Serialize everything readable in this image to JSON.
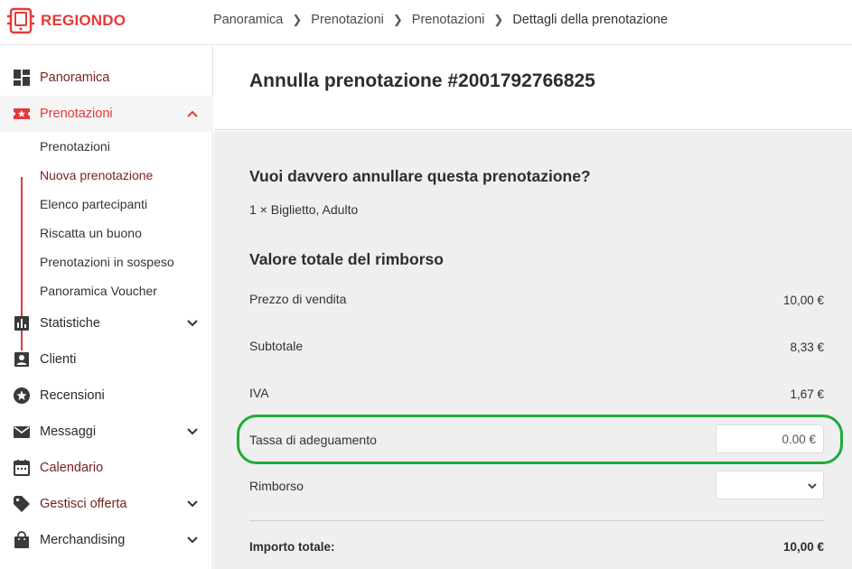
{
  "brand": {
    "name": "REGIONDO",
    "accent": "#e43a3a",
    "highlight": "#1dab3b"
  },
  "breadcrumb": [
    "Panoramica",
    "Prenotazioni",
    "Prenotazioni",
    "Dettagli della prenotazione"
  ],
  "sidebar": {
    "items": [
      {
        "label": "Panoramica",
        "icon": "dashboard-icon"
      },
      {
        "label": "Prenotazioni",
        "icon": "ticket-star-icon",
        "expanded": true
      },
      {
        "label": "Statistiche",
        "icon": "bar-chart-icon"
      },
      {
        "label": "Clienti",
        "icon": "contact-icon"
      },
      {
        "label": "Recensioni",
        "icon": "star-badge-icon"
      },
      {
        "label": "Messaggi",
        "icon": "mail-icon"
      },
      {
        "label": "Calendario",
        "icon": "calendar-icon"
      },
      {
        "label": "Gestisci offerta",
        "icon": "tag-icon"
      },
      {
        "label": "Merchandising",
        "icon": "shopping-bag-icon"
      }
    ],
    "sub_items": [
      "Prenotazioni",
      "Nuova prenotazione",
      "Elenco partecipanti",
      "Riscatta un buono",
      "Prenotazioni in sospeso",
      "Panoramica Voucher"
    ]
  },
  "main": {
    "title": "Annulla prenotazione #2001792766825",
    "question": "Vuoi davvero annullare questa prenotazione?",
    "ticket_line": "1 × Biglietto, Adulto",
    "refund_section_title": "Valore totale del rimborso",
    "rows": [
      {
        "label": "Prezzo di vendita",
        "value": "10,00 €"
      },
      {
        "label": "Subtotale",
        "value": "8,33 €"
      },
      {
        "label": "IVA",
        "value": "1,67 €"
      }
    ],
    "fee_label": "Tassa di adeguamento",
    "fee_value": "0.00 €",
    "refund_label": "Rimborso",
    "refund_select_value": "",
    "total_label": "Importo totale:",
    "total_value": "10,00 €"
  }
}
